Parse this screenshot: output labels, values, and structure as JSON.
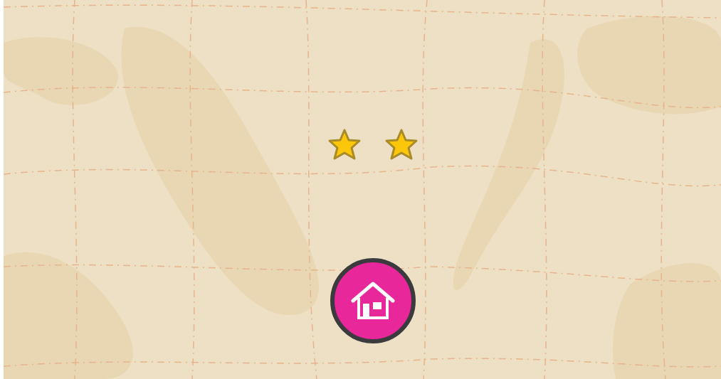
{
  "rating": [
    {
      "filled": true
    },
    {
      "filled": true
    }
  ]
}
